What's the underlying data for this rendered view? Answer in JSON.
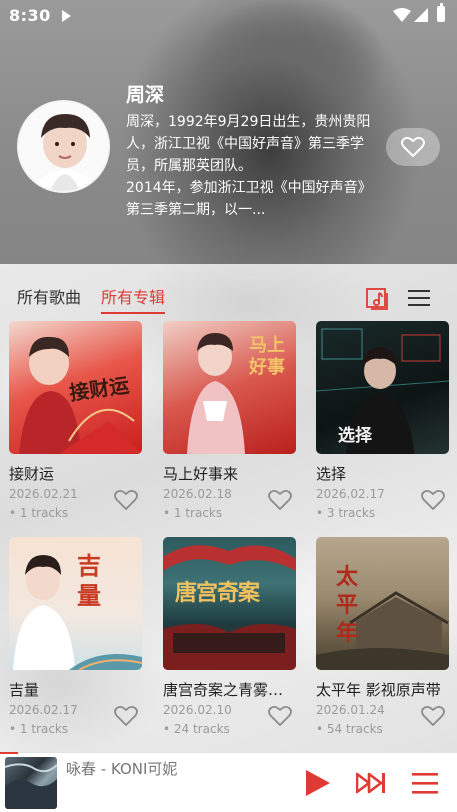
{
  "status": {
    "time": "8:30"
  },
  "artist": {
    "name": "周深",
    "bio": "周深，1992年9月29日出生，贵州贵阳人，浙江卫视《中国好声音》第三季学员，所属那英团队。\n2014年，参加浙江卫视《中国好声音》第三季第二期，以一..."
  },
  "tabs": [
    {
      "label": "所有歌曲",
      "active": false
    },
    {
      "label": "所有专辑",
      "active": true
    }
  ],
  "albums": [
    {
      "title": "接财运",
      "date": "2026.02.21",
      "tracks": "• 1 tracks",
      "cover_text": "接财运"
    },
    {
      "title": "马上好事来",
      "date": "2026.02.18",
      "tracks": "• 1 tracks",
      "cover_text": "马上好事"
    },
    {
      "title": "选择",
      "date": "2026.02.17",
      "tracks": "• 3 tracks",
      "cover_text": "选择"
    },
    {
      "title": "吉量",
      "date": "2026.02.17",
      "tracks": "• 1 tracks",
      "cover_text": "吉量"
    },
    {
      "title": "唐宫奇案之青雾风鸣",
      "date": "2026.02.10",
      "tracks": "• 24 tracks",
      "cover_text": "唐宫奇案"
    },
    {
      "title": "太平年 影视原声带",
      "date": "2026.01.24",
      "tracks": "• 54 tracks",
      "cover_text": "太平年"
    }
  ],
  "player": {
    "now_playing": "咏春 - KONI可妮"
  },
  "colors": {
    "accent": "#e03a34"
  }
}
